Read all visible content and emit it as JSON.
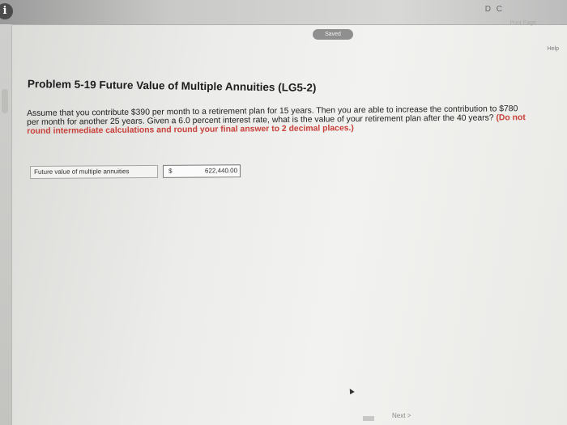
{
  "header": {
    "info_icon_glyph": "i",
    "toolbar_icons": "D C",
    "top_link": "Print Page"
  },
  "status": {
    "saved_label": "Saved"
  },
  "help": {
    "label": "Help"
  },
  "problem": {
    "title": "Problem 5-19 Future Value of Multiple Annuities (LG5-2)",
    "text_line1": "Assume that you contribute $390 per month to a retirement plan for 15 years. Then you are able to increase the contribution to $780",
    "text_line2": "per month for another 25 years. Given a 6.0 percent interest rate, what is the value of your retirement plan after the 40 years?",
    "note_inline": "(Do not",
    "note_line3": "round intermediate calculations and round your final answer to 2 decimal places.)"
  },
  "answer": {
    "label": "Future value of multiple annuities",
    "currency": "$",
    "value": "622,440.00"
  },
  "footer": {
    "next_label": "Next",
    "next_icon": ">"
  },
  "colors": {
    "note_red": "#c9413b",
    "title_text": "#1e1e1e"
  }
}
